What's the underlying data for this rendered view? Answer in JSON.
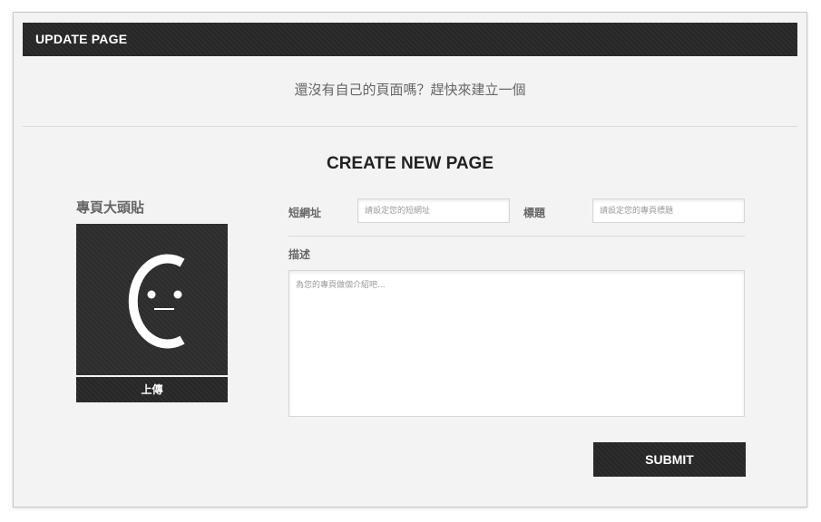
{
  "header": {
    "title": "UPDATE PAGE"
  },
  "intro": {
    "prompt": "還沒有自己的頁面嗎？趕快來建立一個"
  },
  "form": {
    "title": "CREATE NEW PAGE",
    "avatar": {
      "label": "專頁大頭貼",
      "upload_label": "上傳",
      "icon": "placeholder-face-icon"
    },
    "short_url": {
      "label": "短網址",
      "placeholder": "請設定您的短網址",
      "value": ""
    },
    "page_title": {
      "label": "標題",
      "placeholder": "請設定您的專頁標題",
      "value": ""
    },
    "description": {
      "label": "描述",
      "placeholder": "為您的專頁做個介紹吧...",
      "value": ""
    },
    "submit_label": "SUBMIT"
  },
  "colors": {
    "panel_bg": "#f3f3f3",
    "bar_bg": "#262626",
    "avatar_bg": "#2c2c2c",
    "text_muted": "#666666",
    "heading": "#222222"
  }
}
